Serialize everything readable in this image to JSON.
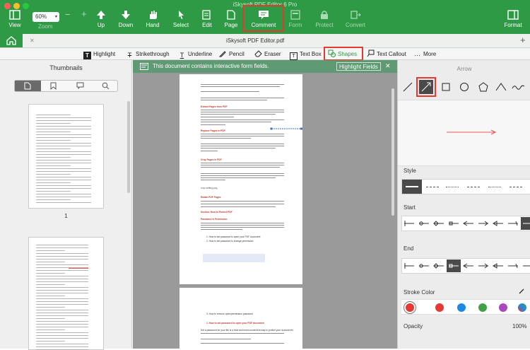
{
  "app": {
    "title": "iSkysoft PDF Editor 6 Pro"
  },
  "toolbar_top": {
    "view": "View",
    "zoom_value": "60%",
    "zoom": "Zoom",
    "up": "Up",
    "down": "Down",
    "hand": "Hand",
    "select": "Select",
    "edit": "Edit",
    "page": "Page",
    "comment": "Comment",
    "form": "Form",
    "protect": "Protect",
    "convert": "Convert",
    "format": "Format"
  },
  "tab": {
    "filename": "iSkysoft PDF Editor.pdf"
  },
  "comment_toolbar": {
    "highlight": "Highlight",
    "strikethrough": "Strikethrough",
    "underline": "Underline",
    "pencil": "Pencil",
    "eraser": "Eraser",
    "textbox": "Text Box",
    "shapes": "Shapes",
    "textcallout": "Text Callout",
    "more": "More"
  },
  "left": {
    "title": "Thumbnails",
    "page_label": "1"
  },
  "banner": {
    "text": "This document contains interactive form fields.",
    "button": "Highlight Fields"
  },
  "doc": {
    "h1": "Extract Pages from PDF",
    "h2": "Replace Pages in PDF",
    "h3": "Crop Pages in PDF",
    "h4": "Rotate PDF Pages",
    "h5": "Section:  How to Protect PDF",
    "h6": "Password & Permission",
    "crop_text": "crop setting.png",
    "list1": "1.  How to set password to open your PDF document",
    "list2": "2.  How to set password to change permission",
    "p2_list": "3.  How to remove open/permission password",
    "p2_h": "1.  How to set password to open your PDF document",
    "p2_text": "Set a password for your file is a best and most convenient way to protect your document's"
  },
  "right": {
    "title": "Arrow",
    "style": "Style",
    "start": "Start",
    "end": "End",
    "stroke": "Stroke Color",
    "opacity": "Opacity",
    "opacity_value": "100%"
  },
  "colors": {
    "green": "#2f9a45",
    "highlight_red": "#e23a2e",
    "banner": "#5f9a74",
    "stroke_swatches": [
      "#e53935",
      "#1e88e5",
      "#43a047",
      "#ab47bc"
    ]
  }
}
